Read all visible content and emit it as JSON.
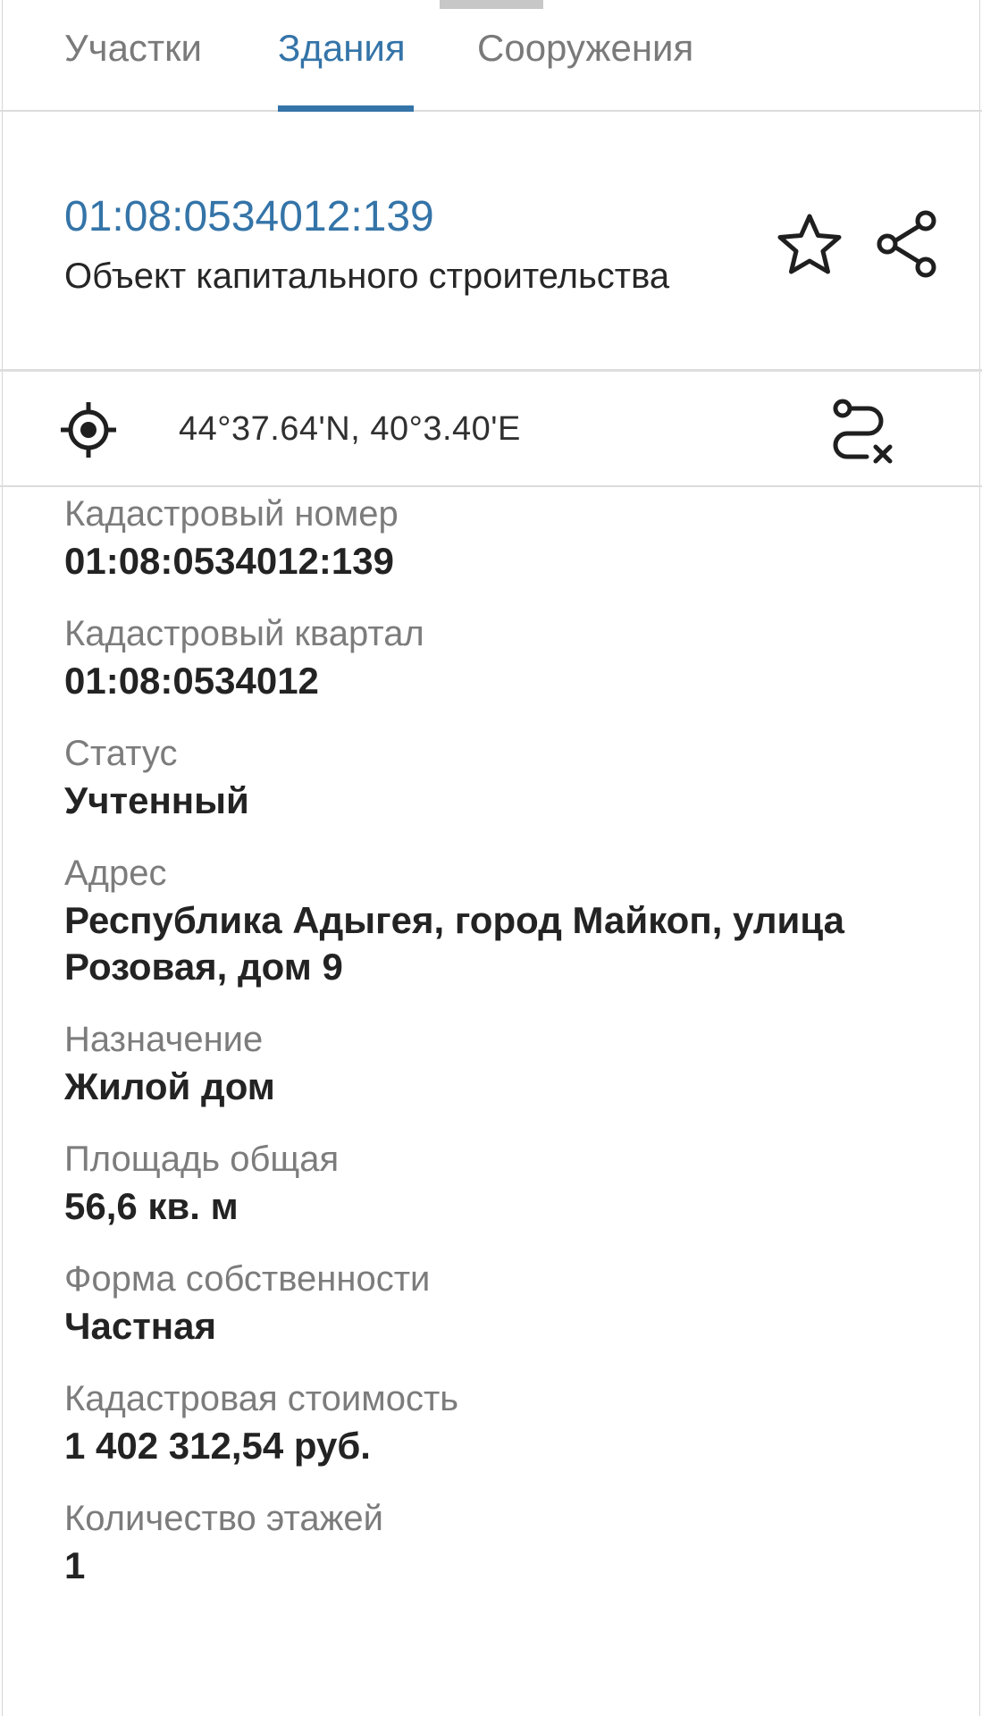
{
  "tabs": [
    {
      "label": "Участки",
      "active": false
    },
    {
      "label": "Здания",
      "active": true
    },
    {
      "label": "Сооружения",
      "active": false
    }
  ],
  "header": {
    "cadastral_number": "01:08:0534012:139",
    "object_type": "Объект капитального строительства",
    "icons": [
      "star-icon",
      "share-icon"
    ]
  },
  "location": {
    "coordinates": "44°37.64'N, 40°3.40'E",
    "icons": [
      "crosshair-icon",
      "route-clear-icon"
    ]
  },
  "properties": [
    {
      "label": "Кадастровый номер",
      "value": "01:08:0534012:139"
    },
    {
      "label": "Кадастровый квартал",
      "value": "01:08:0534012"
    },
    {
      "label": "Статус",
      "value": "Учтенный"
    },
    {
      "label": "Адрес",
      "value": "Республика Адыгея, город Майкоп, улица Розовая, дом 9"
    },
    {
      "label": "Назначение",
      "value": "Жилой дом"
    },
    {
      "label": "Площадь общая",
      "value": "56,6 кв. м"
    },
    {
      "label": "Форма собственности",
      "value": "Частная"
    },
    {
      "label": "Кадастровая стоимость",
      "value": "1 402 312,54 руб."
    },
    {
      "label": "Количество этажей",
      "value": "1"
    }
  ],
  "colors": {
    "accent": "#3474a8",
    "label": "#7c7c7c",
    "text": "#232323",
    "divider": "#dcdcdc"
  }
}
